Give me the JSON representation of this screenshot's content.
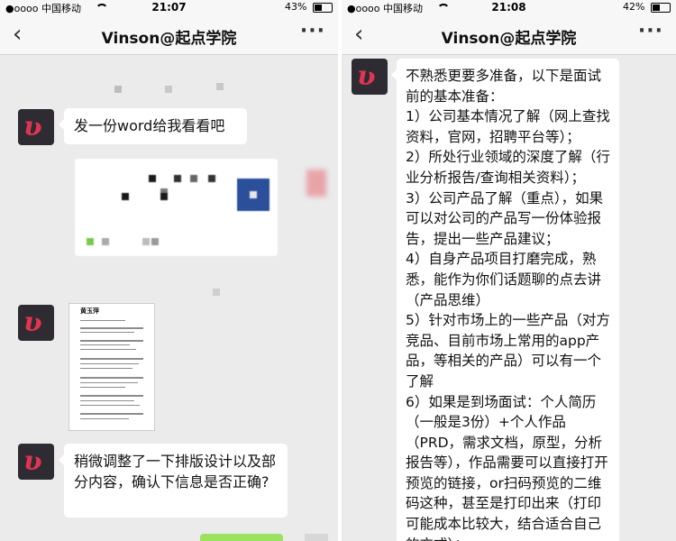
{
  "left": {
    "status": {
      "carrier": "●oooo 中国移动",
      "time": "21:07",
      "battery": "43%",
      "battery_fraction": 0.43
    },
    "nav": {
      "back": "‹",
      "title": "Vinson@起点学院",
      "more": "···"
    },
    "messages": [
      {
        "type": "text",
        "text": "发一份word给我看看吧"
      },
      {
        "type": "blurred-image"
      },
      {
        "type": "doc-image",
        "name": "黄玉萍"
      },
      {
        "type": "text",
        "text": "稍微调整了一下排版设计以及部分内容，确认下信息是否正确?"
      }
    ]
  },
  "right": {
    "status": {
      "carrier": "●oooo 中国移动",
      "time": "21:08",
      "battery": "42%",
      "battery_fraction": 0.42
    },
    "nav": {
      "back": "‹",
      "title": "Vinson@起点学院",
      "more": "···"
    },
    "message": {
      "paragraphs": [
        "不熟悉更要多准备，以下是面试前的基本准备：",
        "1）公司基本情况了解（网上查找资料，官网，招聘平台等）；",
        "2）所处行业领域的深度了解（行业分析报告/查询相关资料）；",
        "3）公司产品了解（重点），如果可以对公司的产品写一份体验报告，提出一些产品建议；",
        "4）自身产品项目打磨完成，熟悉，能作为你们话题聊的点去讲（产品思维）",
        "5）针对市场上的一些产品（对方竞品、目前市场上常用的app产品，等相关的产品）可以有一个了解",
        "6）如果是到场面试：个人简历（一般是3份）+个人作品（PRD，需求文档，原型，分析报告等），作品需要可以直接打开预览的链接，or扫码预览的二维码这种，甚至是打印出来（打印可能成本比较大，结合适合自己的方式）；"
      ]
    }
  },
  "colors": {
    "chat_bg": "#ebebeb",
    "bar_bg": "#f7f7f7",
    "bubble": "#ffffff",
    "avatar_bg": "#2e2b33",
    "avatar_mark": "#e0354f",
    "sent_bubble": "#9be260"
  },
  "icons": [
    "back-chevron-icon",
    "more-icon",
    "wifi-icon",
    "battery-icon",
    "avatar-logo-icon"
  ]
}
